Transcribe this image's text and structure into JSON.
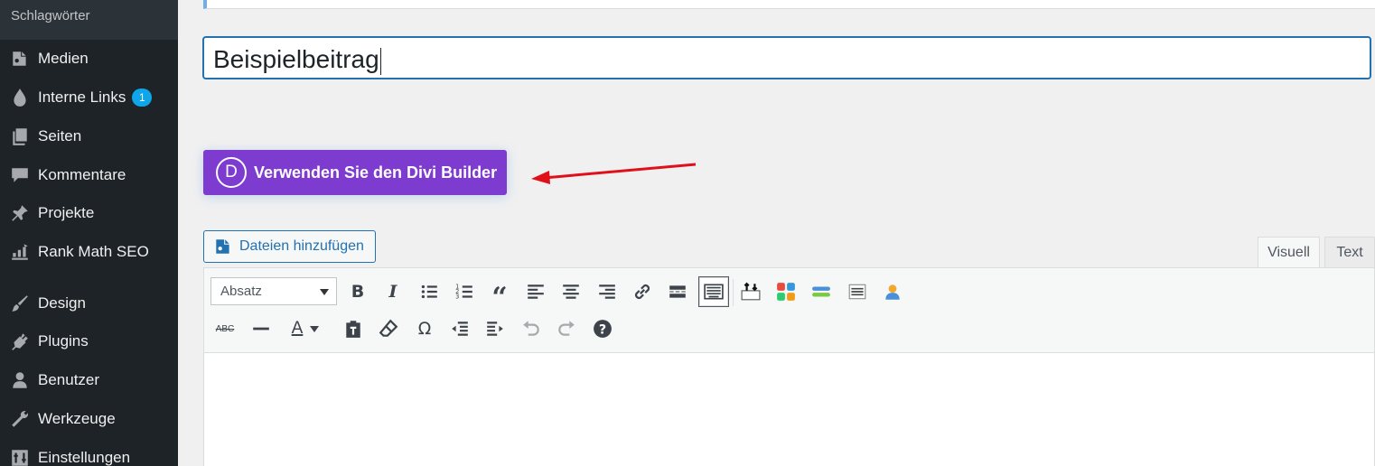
{
  "sidebar": {
    "sub_item": "Schlagwörter",
    "items": [
      {
        "label": "Medien",
        "icon": "media-icon"
      },
      {
        "label": "Interne Links",
        "icon": "link-drop-icon",
        "badge": "1"
      },
      {
        "label": "Seiten",
        "icon": "pages-icon"
      },
      {
        "label": "Kommentare",
        "icon": "comments-icon"
      },
      {
        "label": "Projekte",
        "icon": "pin-icon"
      },
      {
        "label": "Rank Math SEO",
        "icon": "rank-math-icon"
      },
      {
        "label": "Design",
        "icon": "brush-icon"
      },
      {
        "label": "Plugins",
        "icon": "plugin-icon"
      },
      {
        "label": "Benutzer",
        "icon": "user-icon"
      },
      {
        "label": "Werkzeuge",
        "icon": "wrench-icon"
      },
      {
        "label": "Einstellungen",
        "icon": "settings-icon"
      }
    ]
  },
  "title_value": "Beispielbeitrag",
  "divi": {
    "logo_letter": "D",
    "label": "Verwenden Sie den Divi Builder"
  },
  "add_media_label": "Dateien hinzufügen",
  "tabs": {
    "visual": "Visuell",
    "text": "Text"
  },
  "format_select": "Absatz",
  "colors": {
    "divi_purple": "#7e3bd0",
    "sidebar_bg": "#1d2327",
    "accent_blue": "#2271b1",
    "arrow_red": "#e0101a",
    "badge": "#0ea5e9"
  }
}
